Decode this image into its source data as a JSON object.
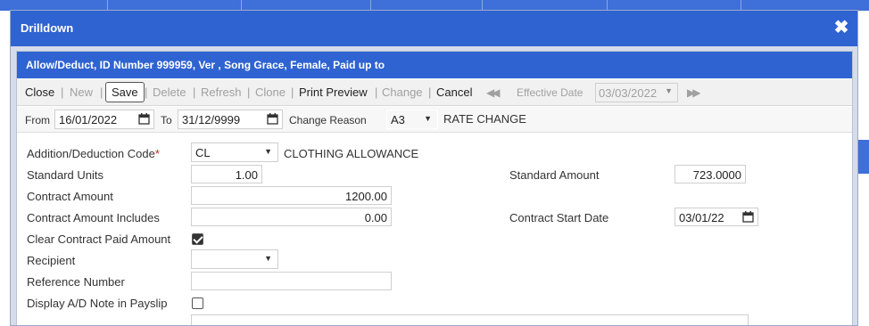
{
  "dialog": {
    "title": "Drilldown",
    "close_icon": "close-x-icon"
  },
  "panel": {
    "title": "Allow/Deduct, ID Number 999959, Ver , Song Grace, Female, Paid up to"
  },
  "toolbar": {
    "close": "Close",
    "new": "New",
    "save": "Save",
    "delete": "Delete",
    "refresh": "Refresh",
    "clone": "Clone",
    "print_preview": "Print Preview",
    "change": "Change",
    "cancel": "Cancel",
    "separator": "|",
    "effective_date_label": "Effective Date",
    "effective_date_value": "03/03/2022",
    "prev_icon": "rewind-icon",
    "next_icon": "fast-forward-icon"
  },
  "date_row": {
    "from_label": "From",
    "from_value": "16/01/2022",
    "to_label": "To",
    "to_value": "31/12/9999",
    "change_reason_label": "Change Reason",
    "change_reason_code": "A3",
    "change_reason_text": "RATE CHANGE"
  },
  "form": {
    "ad_code_label": "Addition/Deduction Code",
    "required_mark": "*",
    "ad_code_value": "CL",
    "ad_code_desc": "CLOTHING ALLOWANCE",
    "standard_units_label": "Standard Units",
    "standard_units_value": "1.00",
    "standard_amount_label": "Standard Amount",
    "standard_amount_value": "723.0000",
    "contract_amount_label": "Contract Amount",
    "contract_amount_value": "1200.00",
    "contract_amount_includes_label": "Contract Amount Includes",
    "contract_amount_includes_value": "0.00",
    "contract_start_date_label": "Contract Start Date",
    "contract_start_date_value": "03/01/22",
    "clear_contract_label": "Clear Contract Paid Amount",
    "clear_contract_checked": true,
    "recipient_label": "Recipient",
    "recipient_value": "",
    "reference_number_label": "Reference Number",
    "reference_number_value": "",
    "display_note_label": "Display A/D Note in Payslip",
    "display_note_checked": false
  }
}
